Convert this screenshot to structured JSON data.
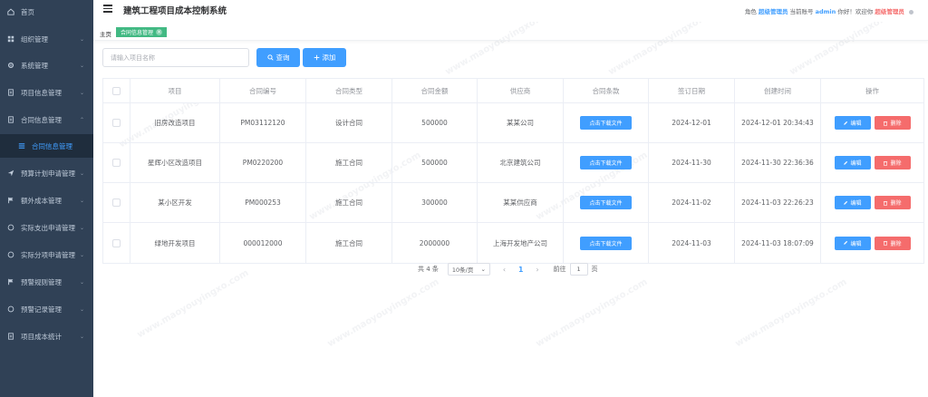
{
  "sidebar": {
    "items": [
      {
        "label": "首页",
        "icon": "home-icon",
        "has_chevron": false
      },
      {
        "label": "组织管理",
        "icon": "grid-icon",
        "has_chevron": true
      },
      {
        "label": "系统管理",
        "icon": "gear-icon",
        "has_chevron": true
      },
      {
        "label": "项目信息管理",
        "icon": "document-icon",
        "has_chevron": true
      },
      {
        "label": "合同信息管理",
        "icon": "document-icon",
        "has_chevron": true,
        "expanded": true
      },
      {
        "label": "合同信息管理",
        "icon": "list-icon",
        "sub": true,
        "active": true
      },
      {
        "label": "预算计划申请管理",
        "icon": "send-icon",
        "has_chevron": true
      },
      {
        "label": "额外成本管理",
        "icon": "flag-icon",
        "has_chevron": true
      },
      {
        "label": "实际支出申请管理",
        "icon": "circle-icon",
        "has_chevron": true
      },
      {
        "label": "实际分项申请管理",
        "icon": "circle-icon",
        "has_chevron": true
      },
      {
        "label": "预警规则管理",
        "icon": "flag-icon",
        "has_chevron": true
      },
      {
        "label": "预警记录管理",
        "icon": "circle-icon",
        "has_chevron": true
      },
      {
        "label": "项目成本统计",
        "icon": "document-icon",
        "has_chevron": true
      }
    ]
  },
  "header": {
    "title": "建筑工程项目成本控制系统",
    "role_label": "角色",
    "role_value": "超级管理员",
    "account_label": "当前账号",
    "account_value": "admin",
    "greeting": "你好！欢迎你",
    "welcome_name": "超级管理员"
  },
  "tags": {
    "home": "主页",
    "active_tag": "合同信息管理",
    "close_glyph": "×"
  },
  "toolbar": {
    "search_placeholder": "请输入项目名称",
    "query_label": "查询",
    "add_label": "添加"
  },
  "table": {
    "columns": [
      "项目",
      "合同编号",
      "合同类型",
      "合同金额",
      "供应商",
      "合同条款",
      "签订日期",
      "创建时间",
      "操作"
    ],
    "download_label": "点击下载文件",
    "edit_label": "编辑",
    "delete_label": "删除",
    "rows": [
      {
        "project": "旧房改造项目",
        "contract_no": "PM03112120",
        "type": "设计合同",
        "amount": "500000",
        "supplier": "某某公司",
        "signed": "2024-12-01",
        "created": "2024-12-01 20:34:43"
      },
      {
        "project": "星辉小区改造项目",
        "contract_no": "PM0220200",
        "type": "施工合同",
        "amount": "500000",
        "supplier": "北京建筑公司",
        "signed": "2024-11-30",
        "created": "2024-11-30 22:36:36"
      },
      {
        "project": "某小区开发",
        "contract_no": "PM000253",
        "type": "施工合同",
        "amount": "300000",
        "supplier": "某某供应商",
        "signed": "2024-11-02",
        "created": "2024-11-03 22:26:23"
      },
      {
        "project": "绿地开发项目",
        "contract_no": "000012000",
        "type": "施工合同",
        "amount": "2000000",
        "supplier": "上海开发地产公司",
        "signed": "2024-11-03",
        "created": "2024-11-03 18:07:09"
      }
    ]
  },
  "pagination": {
    "total": "共 4 条",
    "page_size": "10条/页",
    "prev": "‹",
    "current": "1",
    "next": "›",
    "jump_label": "前往",
    "jump_value": "1",
    "jump_suffix": "页"
  },
  "watermark": "www.maoyouyingxo.com",
  "colors": {
    "sidebar_bg": "#304156",
    "primary": "#409eff",
    "danger": "#f56c6c",
    "tag_green": "#42b983"
  }
}
